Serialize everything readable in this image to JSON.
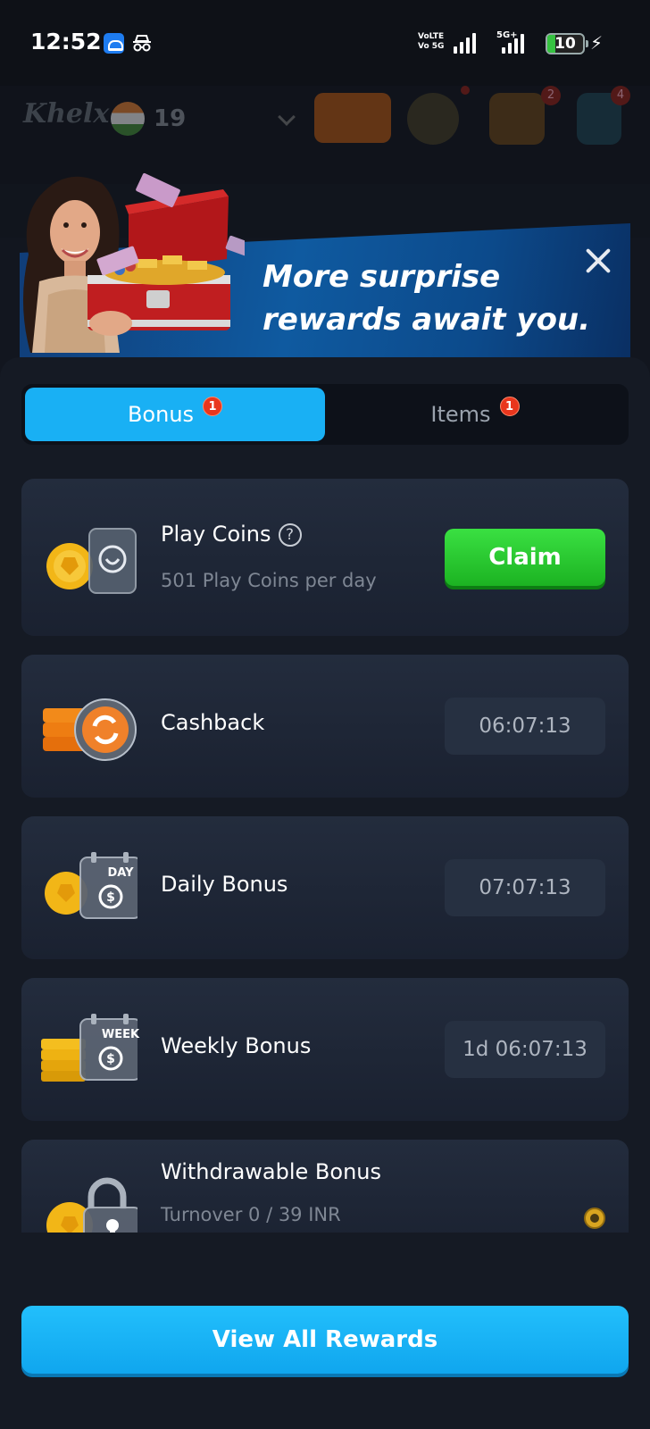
{
  "status_bar": {
    "time": "12:52",
    "network_label": "VoLTE Vo 5G",
    "network_5g": "5G+",
    "battery": "10"
  },
  "header": {
    "logo": "Khelx",
    "count": "19"
  },
  "banner": {
    "text": "More surprise rewards await you."
  },
  "tabs": [
    {
      "label": "Bonus",
      "badge": "1",
      "active": true
    },
    {
      "label": "Items",
      "badge": "1",
      "active": false
    }
  ],
  "rewards": {
    "play_coins": {
      "title": "Play Coins",
      "help": "?",
      "subtitle": "501 Play Coins per day",
      "action": "Claim"
    },
    "cashback": {
      "title": "Cashback",
      "timer": "06:07:13"
    },
    "daily": {
      "title": "Daily Bonus",
      "timer": "07:07:13",
      "icon_text": "DAY"
    },
    "weekly": {
      "title": "Weekly Bonus",
      "timer": "1d 06:07:13",
      "icon_text": "WEEK"
    },
    "withdrawable": {
      "title": "Withdrawable Bonus",
      "subtitle": "Turnover 0 / 39 INR",
      "progress": 0.0
    }
  },
  "footer": {
    "view_all": "View All Rewards"
  },
  "colors": {
    "accent": "#19b0f4",
    "claim": "#22c02a",
    "badge": "#e9361d"
  }
}
